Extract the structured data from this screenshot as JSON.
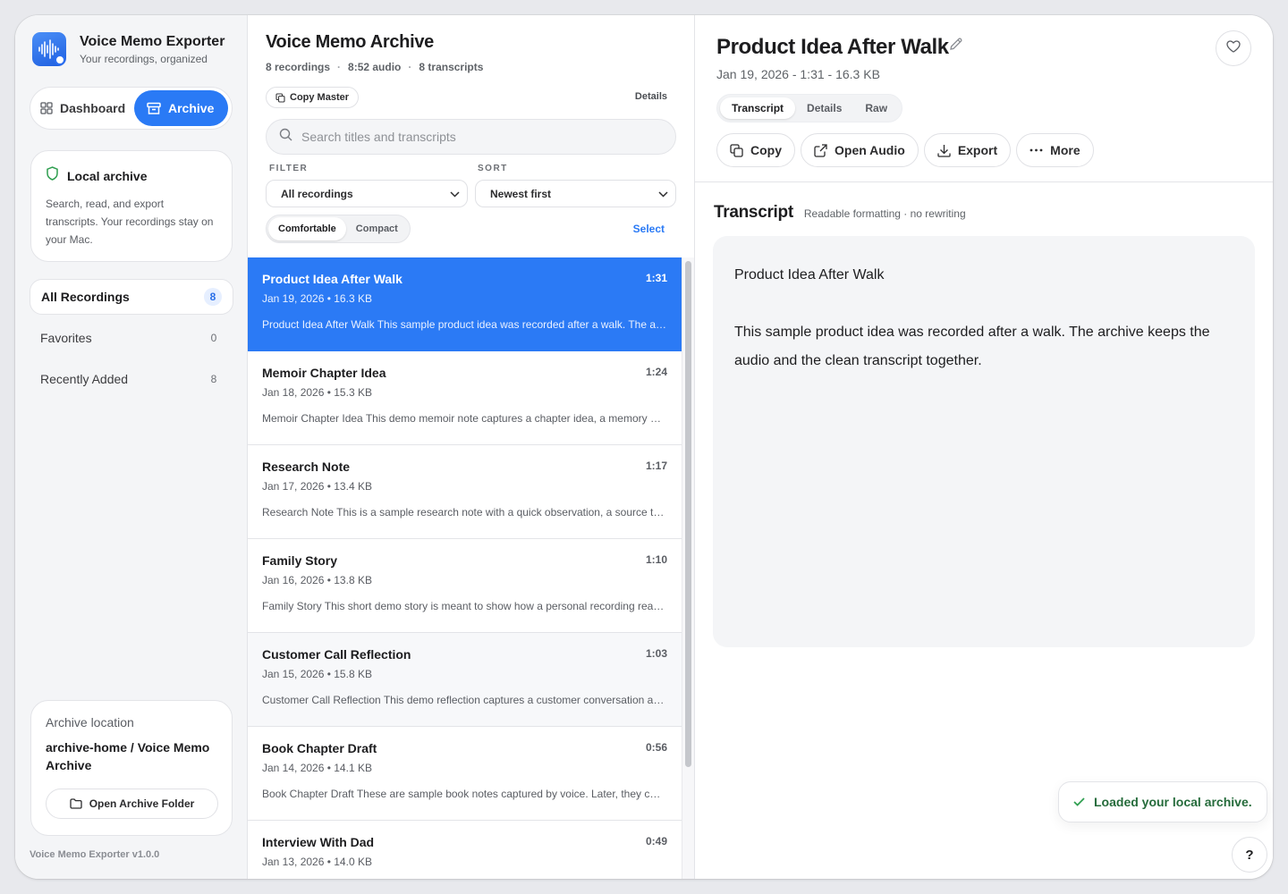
{
  "app": {
    "title": "Voice Memo Exporter",
    "subtitle": "Your recordings, organized",
    "version": "Voice Memo Exporter v1.0.0"
  },
  "main_tabs": [
    {
      "label": "Dashboard",
      "icon": "grid-icon",
      "active": false
    },
    {
      "label": "Archive",
      "icon": "archive-box-icon",
      "active": true
    }
  ],
  "local_card": {
    "title": "Local archive",
    "description": "Search, read, and export transcripts. Your recordings stay on your Mac."
  },
  "nav": [
    {
      "label": "All Recordings",
      "count": "8",
      "active": true
    },
    {
      "label": "Favorites",
      "count": "0",
      "active": false
    },
    {
      "label": "Recently Added",
      "count": "8",
      "active": false
    }
  ],
  "location": {
    "label": "Archive location",
    "path": "archive-home / Voice Memo Archive",
    "button": "Open Archive Folder"
  },
  "list": {
    "title": "Voice Memo Archive",
    "meta": [
      "8 recordings",
      "8:52 audio",
      "8 transcripts"
    ],
    "copy_master": "Copy Master",
    "details_link": "Details",
    "search_placeholder": "Search titles and transcripts",
    "filter_label": "FILTER",
    "sort_label": "SORT",
    "filter_value": "All recordings",
    "sort_value": "Newest first",
    "density": [
      {
        "label": "Comfortable",
        "active": true
      },
      {
        "label": "Compact",
        "active": false
      }
    ],
    "select_link": "Select",
    "rows": [
      {
        "title": "Product Idea After Walk",
        "duration": "1:31",
        "meta": "Jan 19, 2026 • 16.3 KB",
        "snippet": "Product Idea After Walk This sample product idea was recorded after a walk. The archive keeps the audio and the clean transcript together.",
        "active": true
      },
      {
        "title": "Memoir Chapter Idea",
        "duration": "1:24",
        "meta": "Jan 18, 2026 • 15.3 KB",
        "snippet": "Memoir Chapter Idea This demo memoir note captures a chapter idea, a memory and a few details to revisit later.",
        "active": false
      },
      {
        "title": "Research Note",
        "duration": "1:17",
        "meta": "Jan 17, 2026 • 13.4 KB",
        "snippet": "Research Note This is a sample research note with a quick observation, a source to check and a follow-up question.",
        "active": false
      },
      {
        "title": "Family Story",
        "duration": "1:10",
        "meta": "Jan 16, 2026 • 13.8 KB",
        "snippet": "Family Story This short demo story is meant to show how a personal recording reads once it is transcribed.",
        "active": false
      },
      {
        "title": "Customer Call Reflection",
        "duration": "1:03",
        "meta": "Jan 15, 2026 • 15.8 KB",
        "snippet": "Customer Call Reflection This demo reflection captures a customer conversation and the main takeaways from it.",
        "active": false
      },
      {
        "title": "Book Chapter Draft",
        "duration": "0:56",
        "meta": "Jan 14, 2026 • 14.1 KB",
        "snippet": "Book Chapter Draft These are sample book notes captured by voice. Later, they can be shaped into a full chapter.",
        "active": false
      },
      {
        "title": "Interview With Dad",
        "duration": "0:49",
        "meta": "Jan 13, 2026 • 14.0 KB",
        "snippet": "",
        "active": false
      }
    ]
  },
  "detail": {
    "title": "Product Idea After Walk",
    "meta": "Jan 19, 2026 - 1:31 - 16.3 KB",
    "tabs": [
      {
        "label": "Transcript",
        "active": true
      },
      {
        "label": "Details",
        "active": false
      },
      {
        "label": "Raw",
        "active": false
      }
    ],
    "actions": [
      {
        "label": "Copy",
        "icon": "copy-icon"
      },
      {
        "label": "Open Audio",
        "icon": "external-link-icon"
      },
      {
        "label": "Export",
        "icon": "download-icon"
      },
      {
        "label": "More",
        "icon": "ellipsis-icon"
      }
    ],
    "transcript_title": "Transcript",
    "transcript_sub": "Readable formatting · no rewriting",
    "paragraphs": [
      "Product Idea After Walk",
      "This sample product idea was recorded after a walk. The archive keeps the audio and the clean transcript together."
    ]
  },
  "toast": "Loaded your local archive.",
  "help": "?",
  "colors": {
    "accent": "#2a7af5",
    "success": "#2e9e4f"
  }
}
